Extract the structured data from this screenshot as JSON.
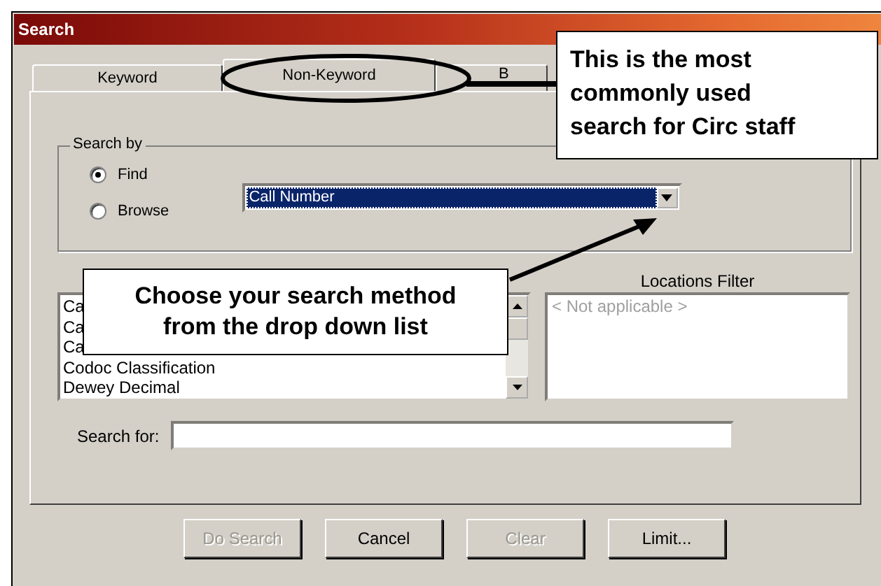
{
  "window": {
    "title": "Search"
  },
  "tabs": [
    {
      "label": "Keyword",
      "selected": false
    },
    {
      "label": "Non-Keyword",
      "selected": true
    },
    {
      "label": "B",
      "selected": false
    }
  ],
  "search_by": {
    "label": "Search by",
    "options": [
      {
        "label": "Find",
        "selected": true
      },
      {
        "label": "Browse",
        "selected": false
      }
    ],
    "dropdown": {
      "value": "Call Number"
    }
  },
  "heading_types_filter": {
    "items": [
      "Ca",
      "Ca",
      "Ca",
      "Codoc Classification",
      "Dewey Decimal"
    ]
  },
  "locations_filter": {
    "label": "Locations Filter",
    "placeholder": "< Not applicable >"
  },
  "search_for": {
    "label": "Search for:"
  },
  "buttons": [
    {
      "label": "Do Search",
      "disabled": true
    },
    {
      "label": "Cancel",
      "disabled": false
    },
    {
      "label": "Clear",
      "disabled": true
    },
    {
      "label": "Limit...",
      "disabled": false
    }
  ],
  "annotations": [
    {
      "text": "This is the most commonly used search for Circ staff"
    },
    {
      "text": "Choose your search method from the drop down list"
    }
  ]
}
